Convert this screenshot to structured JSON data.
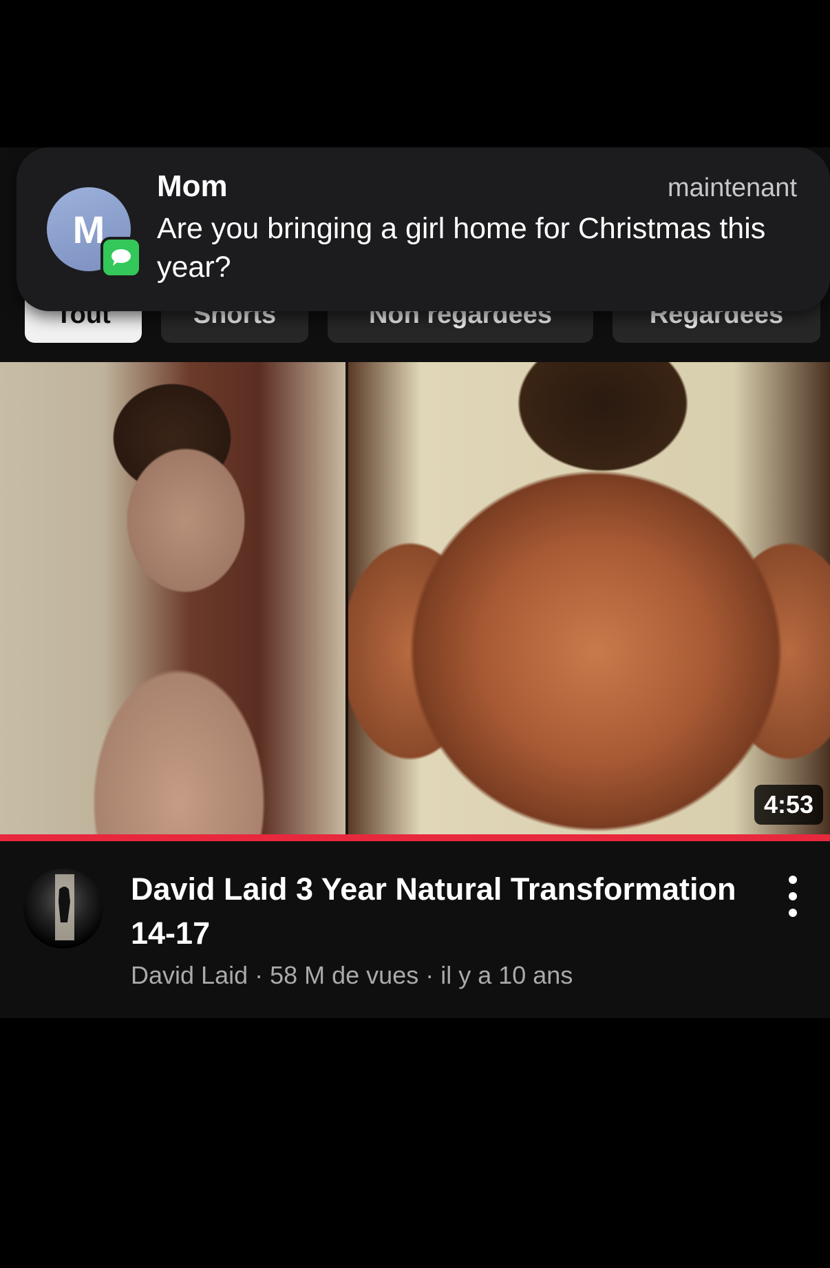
{
  "notification": {
    "avatar_letter": "M",
    "sender": "Mom",
    "time": "maintenant",
    "body": "Are you bringing a girl home for Christmas this year?",
    "app_icon": "messages-icon"
  },
  "chips": [
    {
      "label": "Tout",
      "active": true
    },
    {
      "label": "Shorts",
      "active": false
    },
    {
      "label": "Non regardées",
      "active": false
    },
    {
      "label": "Regardées",
      "active": false
    }
  ],
  "video": {
    "duration": "4:53",
    "progress_fraction": 1.0,
    "title": "David Laid 3 Year Natural Transformation 14-17",
    "meta": "David Laid · 58 M de vues · il y a 10 ans",
    "menu_icon": "more-vert-icon"
  },
  "colors": {
    "progress": "#e8283d",
    "messages_badge": "#34c759",
    "avatar": "#8a9dcc"
  }
}
